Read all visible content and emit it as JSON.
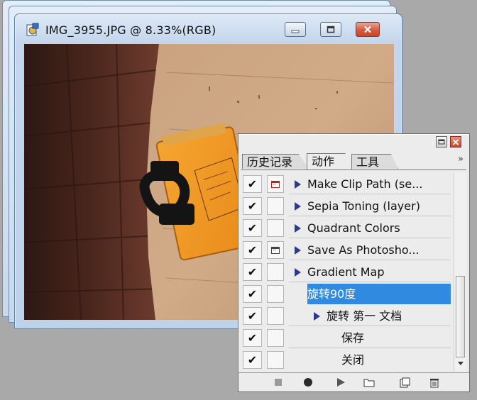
{
  "document_window": {
    "title": "IMG_3955.JPG @ 8.33%(RGB)"
  },
  "actions_panel": {
    "tabs": [
      {
        "label": "历史记录"
      },
      {
        "label": "动作"
      },
      {
        "label": "工具"
      }
    ],
    "more_label": "»",
    "rows": [
      {
        "checked": "✔",
        "name": "Make Clip Path (se..."
      },
      {
        "checked": "✔",
        "name": "Sepia Toning (layer)"
      },
      {
        "checked": "✔",
        "name": "Quadrant Colors"
      },
      {
        "checked": "✔",
        "name": "Save As Photosho..."
      },
      {
        "checked": "✔",
        "name": "Gradient Map"
      },
      {
        "checked": "✔",
        "name": "旋转90度"
      },
      {
        "checked": "✔",
        "name": "旋转 第一 文档"
      },
      {
        "checked": "✔",
        "name": "保存"
      },
      {
        "checked": "✔",
        "name": "关闭"
      }
    ],
    "toolbar_icons": [
      "stop-icon",
      "record-icon",
      "play-icon",
      "folder-icon",
      "new-action-icon",
      "trash-icon"
    ]
  },
  "colors": {
    "selection": "#2f8ae0",
    "triangle": "#2b3a92",
    "close_red": "#c9442c"
  }
}
